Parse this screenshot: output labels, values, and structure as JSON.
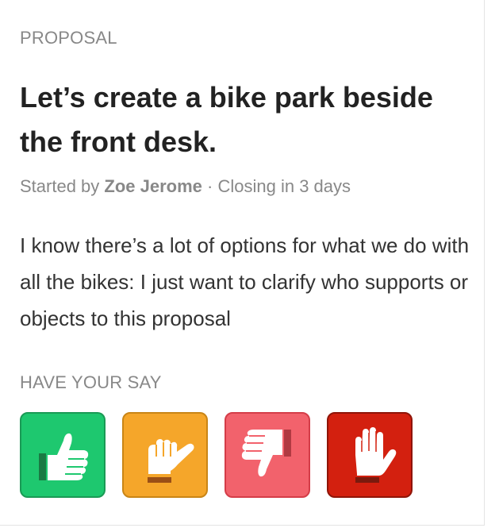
{
  "proposal": {
    "eyebrow": "PROPOSAL",
    "title": "Let’s create a bike park beside the front desk.",
    "meta": {
      "started_by_label": "Started by",
      "author": "Zoe Jerome",
      "separator": "·",
      "closing": "Closing in 3 days"
    },
    "description": "I know there’s a lot of options for what we do with all the bikes: I just want to clarify who supports or objects to this proposal"
  },
  "vote": {
    "heading": "HAVE YOUR SAY",
    "options": [
      {
        "icon": "thumbs-up-icon",
        "color": "#1ec86f",
        "border": "#1a9a55"
      },
      {
        "icon": "thumbs-sideways-icon",
        "color": "#f5a62a",
        "border": "#c98516"
      },
      {
        "icon": "thumbs-down-icon",
        "color": "#f2626c",
        "border": "#d43d48"
      },
      {
        "icon": "raised-hand-icon",
        "color": "#d3200f",
        "border": "#8f1408"
      }
    ]
  }
}
